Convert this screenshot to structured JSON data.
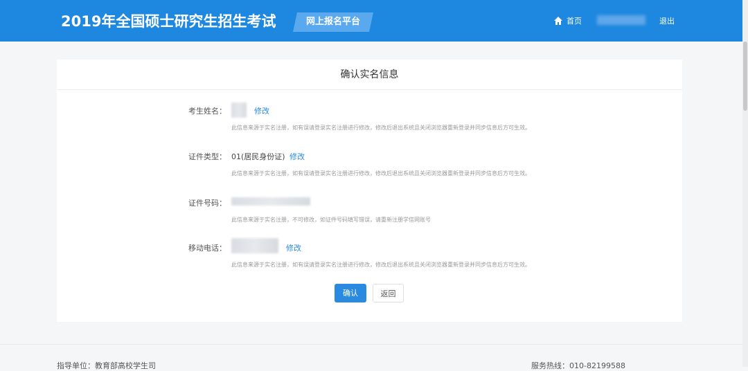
{
  "header": {
    "title": "2019年全国硕士研究生招生考试",
    "badge": "网上报名平台",
    "home": "首页",
    "logout": "退出"
  },
  "card": {
    "title": "确认实名信息",
    "rows": [
      {
        "label": "考生姓名：",
        "value": "",
        "edit": "修改",
        "note": "此信息来源于实名注册，如有误请登录实名注册进行修改，修改后退出系统且关闭浏览器重新登录并同步信息后方可生效。"
      },
      {
        "label": "证件类型：",
        "value": "01(居民身份证)",
        "edit": "修改",
        "note": "此信息来源于实名注册，如有误请登录实名注册进行修改，修改后退出系统且关闭浏览器重新登录并同步信息后方可生效。"
      },
      {
        "label": "证件号码：",
        "value": "",
        "note": "此信息来源于实名注册，不可修改，如证件号码填写错误，请重新注册学信网账号"
      },
      {
        "label": "移动电话：",
        "value": "",
        "edit": "修改",
        "note": "此信息来源于实名注册，如有误请登录实名注册进行修改，修改后退出系统且关闭浏览器重新登录并同步信息后方可生效。"
      }
    ],
    "confirm": "确认",
    "back": "返回"
  },
  "footer": {
    "left": "指导单位：教育部高校学生司",
    "right": "服务热线：010-82199588"
  }
}
